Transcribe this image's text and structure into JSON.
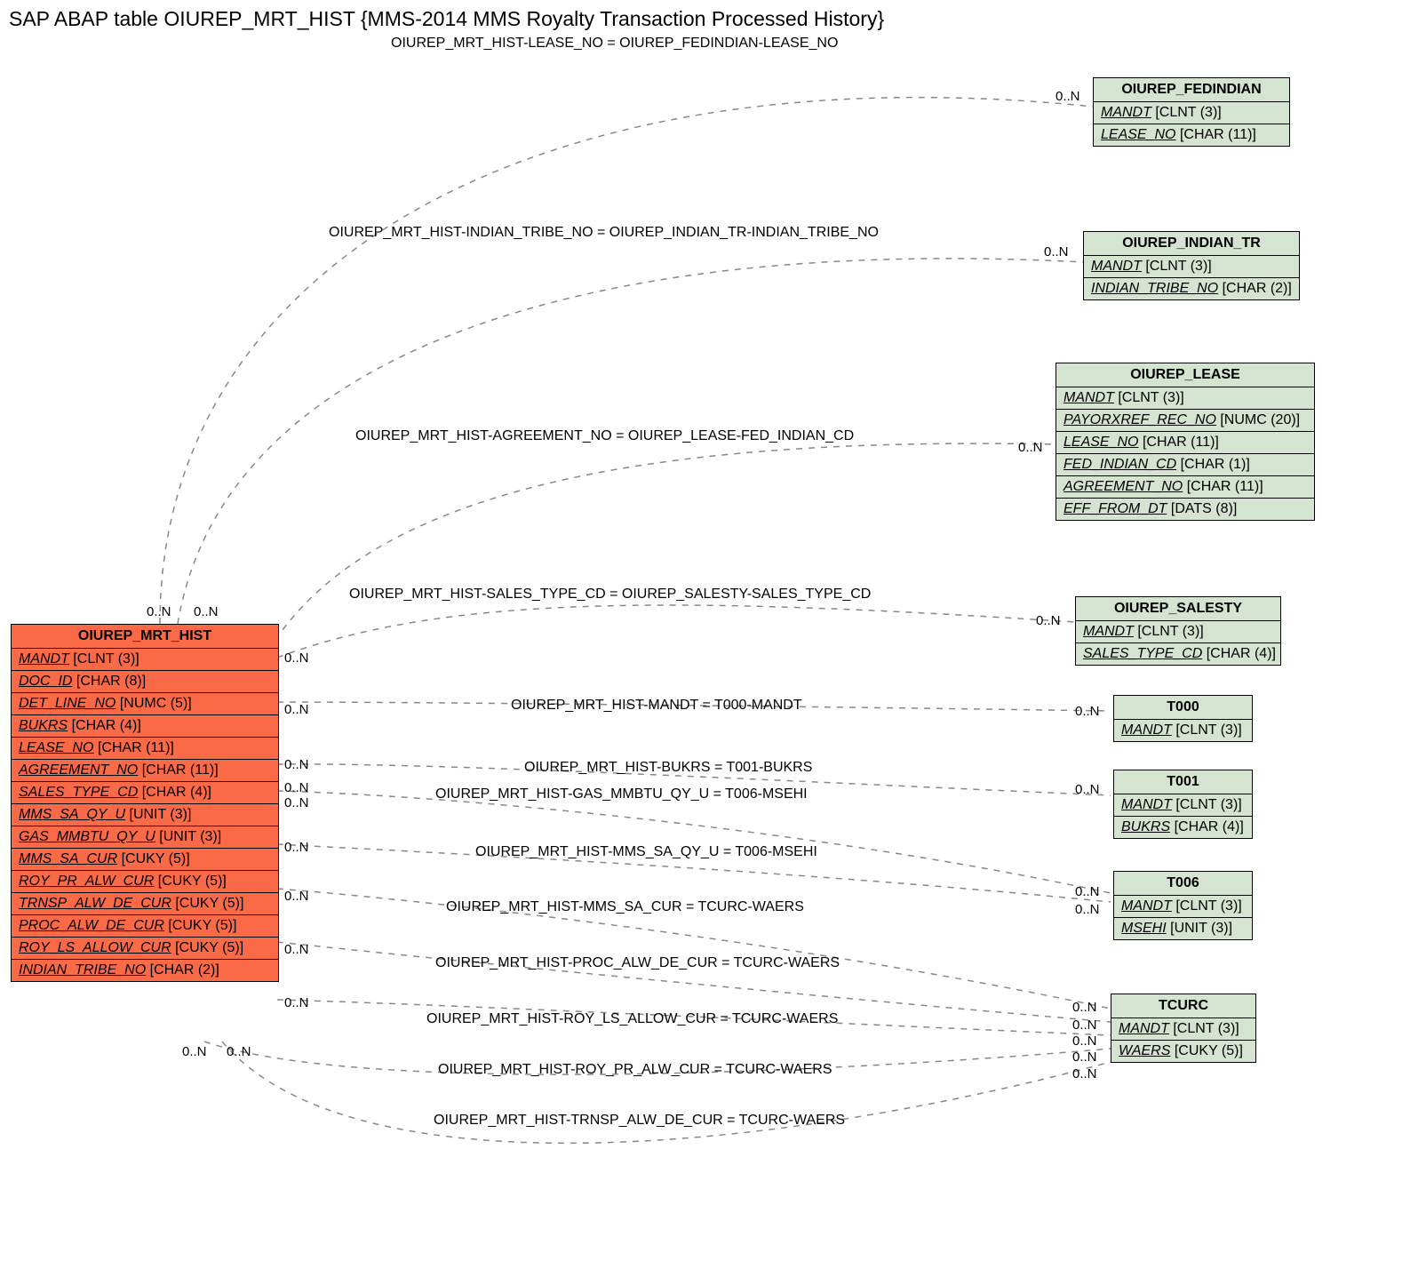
{
  "title": "SAP ABAP table OIUREP_MRT_HIST {MMS-2014 MMS Royalty Transaction Processed History}",
  "main_entity": {
    "name": "OIUREP_MRT_HIST",
    "fields": [
      {
        "name": "MANDT",
        "type": "[CLNT (3)]"
      },
      {
        "name": "DOC_ID",
        "type": "[CHAR (8)]"
      },
      {
        "name": "DET_LINE_NO",
        "type": "[NUMC (5)]"
      },
      {
        "name": "BUKRS",
        "type": "[CHAR (4)]"
      },
      {
        "name": "LEASE_NO",
        "type": "[CHAR (11)]"
      },
      {
        "name": "AGREEMENT_NO",
        "type": "[CHAR (11)]"
      },
      {
        "name": "SALES_TYPE_CD",
        "type": "[CHAR (4)]"
      },
      {
        "name": "MMS_SA_QY_U",
        "type": "[UNIT (3)]"
      },
      {
        "name": "GAS_MMBTU_QY_U",
        "type": "[UNIT (3)]"
      },
      {
        "name": "MMS_SA_CUR",
        "type": "[CUKY (5)]"
      },
      {
        "name": "ROY_PR_ALW_CUR",
        "type": "[CUKY (5)]"
      },
      {
        "name": "TRNSP_ALW_DE_CUR",
        "type": "[CUKY (5)]"
      },
      {
        "name": "PROC_ALW_DE_CUR",
        "type": "[CUKY (5)]"
      },
      {
        "name": "ROY_LS_ALLOW_CUR",
        "type": "[CUKY (5)]"
      },
      {
        "name": "INDIAN_TRIBE_NO",
        "type": "[CHAR (2)]"
      }
    ]
  },
  "entities": {
    "fedindian": {
      "name": "OIUREP_FEDINDIAN",
      "fields": [
        {
          "name": "MANDT",
          "type": "[CLNT (3)]"
        },
        {
          "name": "LEASE_NO",
          "type": "[CHAR (11)]"
        }
      ]
    },
    "indian_tr": {
      "name": "OIUREP_INDIAN_TR",
      "fields": [
        {
          "name": "MANDT",
          "type": "[CLNT (3)]"
        },
        {
          "name": "INDIAN_TRIBE_NO",
          "type": "[CHAR (2)]"
        }
      ]
    },
    "lease": {
      "name": "OIUREP_LEASE",
      "fields": [
        {
          "name": "MANDT",
          "type": "[CLNT (3)]"
        },
        {
          "name": "PAYORXREF_REC_NO",
          "type": "[NUMC (20)]"
        },
        {
          "name": "LEASE_NO",
          "type": "[CHAR (11)]"
        },
        {
          "name": "FED_INDIAN_CD",
          "type": "[CHAR (1)]"
        },
        {
          "name": "AGREEMENT_NO",
          "type": "[CHAR (11)]"
        },
        {
          "name": "EFF_FROM_DT",
          "type": "[DATS (8)]"
        }
      ]
    },
    "salesty": {
      "name": "OIUREP_SALESTY",
      "fields": [
        {
          "name": "MANDT",
          "type": "[CLNT (3)]"
        },
        {
          "name": "SALES_TYPE_CD",
          "type": "[CHAR (4)]"
        }
      ]
    },
    "t000": {
      "name": "T000",
      "fields": [
        {
          "name": "MANDT",
          "type": "[CLNT (3)]"
        }
      ]
    },
    "t001": {
      "name": "T001",
      "fields": [
        {
          "name": "MANDT",
          "type": "[CLNT (3)]"
        },
        {
          "name": "BUKRS",
          "type": "[CHAR (4)]"
        }
      ]
    },
    "t006": {
      "name": "T006",
      "fields": [
        {
          "name": "MANDT",
          "type": "[CLNT (3)]"
        },
        {
          "name": "MSEHI",
          "type": "[UNIT (3)]"
        }
      ]
    },
    "tcurc": {
      "name": "TCURC",
      "fields": [
        {
          "name": "MANDT",
          "type": "[CLNT (3)]"
        },
        {
          "name": "WAERS",
          "type": "[CUKY (5)]"
        }
      ]
    }
  },
  "relations": [
    {
      "label": "OIUREP_MRT_HIST-LEASE_NO = OIUREP_FEDINDIAN-LEASE_NO"
    },
    {
      "label": "OIUREP_MRT_HIST-INDIAN_TRIBE_NO = OIUREP_INDIAN_TR-INDIAN_TRIBE_NO"
    },
    {
      "label": "OIUREP_MRT_HIST-AGREEMENT_NO = OIUREP_LEASE-FED_INDIAN_CD"
    },
    {
      "label": "OIUREP_MRT_HIST-SALES_TYPE_CD = OIUREP_SALESTY-SALES_TYPE_CD"
    },
    {
      "label": "OIUREP_MRT_HIST-MANDT = T000-MANDT"
    },
    {
      "label": "OIUREP_MRT_HIST-BUKRS = T001-BUKRS"
    },
    {
      "label": "OIUREP_MRT_HIST-GAS_MMBTU_QY_U = T006-MSEHI"
    },
    {
      "label": "OIUREP_MRT_HIST-MMS_SA_QY_U = T006-MSEHI"
    },
    {
      "label": "OIUREP_MRT_HIST-MMS_SA_CUR = TCURC-WAERS"
    },
    {
      "label": "OIUREP_MRT_HIST-PROC_ALW_DE_CUR = TCURC-WAERS"
    },
    {
      "label": "OIUREP_MRT_HIST-ROY_LS_ALLOW_CUR = TCURC-WAERS"
    },
    {
      "label": "OIUREP_MRT_HIST-ROY_PR_ALW_CUR = TCURC-WAERS"
    },
    {
      "label": "OIUREP_MRT_HIST-TRNSP_ALW_DE_CUR = TCURC-WAERS"
    }
  ],
  "cardinality": "0..N"
}
